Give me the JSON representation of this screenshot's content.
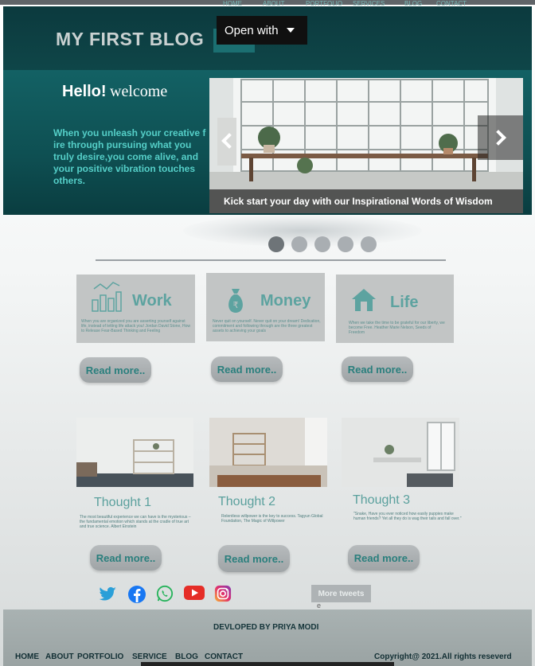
{
  "header": {
    "logo": "MY FIRST BLOG",
    "nav": [
      "HOME",
      "ABOUT",
      "PORTFOLIO",
      "SERVICES",
      "BLOG",
      "CONTACT"
    ],
    "open_with": "Open with"
  },
  "hero": {
    "hello": "Hello!",
    "welcome": "welcome",
    "quote": "When you unleash your creative f ire through pursuing what you truly desire,you come alive, and your positive vibration touches others."
  },
  "carousel": {
    "caption": "Kick start your day with our Inspirational Words of Wisdom",
    "slide_count": 5,
    "active_index": 0
  },
  "cards": [
    {
      "title": "Work",
      "text": "When you are organized you are asserting yourself against life, instead of letting life attack you! Jordan David Stone, How to Release Fear-Based Thinking and Feeling",
      "button": "Read more.."
    },
    {
      "title": "Money",
      "text": "Never quit on yourself. Never quit on your dream! Dedication, commitment and following through are the three greatest assets to achieving your goals",
      "button": "Read more.."
    },
    {
      "title": "Life",
      "text": "When we take the time to be grateful for our liberty, we become Free. Heather Marie Nelson, Seeds of Freedom",
      "button": "Read more.."
    }
  ],
  "thoughts": [
    {
      "title": "Thought 1",
      "text": "The most beautiful experience we can have is the mysterious – the fundamental emotion which stands at the cradle of true art and true science. Albert Einstein",
      "button": "Read more.."
    },
    {
      "title": "Thought 2",
      "text": "Relentless willpower is the key to success. Tagyun Global Foundation, The Magic of Willpower",
      "button": "Read more.."
    },
    {
      "title": "Thought 3",
      "text": "\"Snake, Have you ever noticed how easily puppies make human friends? Yet all they do is wag their tails and fall over.\"",
      "button": "Read more.."
    }
  ],
  "social": {
    "icons": [
      "twitter-icon",
      "facebook-icon",
      "whatsapp-icon",
      "youtube-icon",
      "instagram-icon"
    ],
    "more_tweets": "More tweets",
    "extra": "e"
  },
  "footer": {
    "developed": "DEVLOPED  BY PRIYA MODI",
    "nav": [
      "HOME",
      "ABOUT",
      "PORTFOLIO",
      "SERVICE",
      "BLOG",
      "CONTACT"
    ],
    "copyright": "Copyright@ 2021.All rights reseverd"
  },
  "colors": {
    "hero": "#0f4b4d",
    "accent": "#5da3a0",
    "quote": "#55cfc8",
    "card": "#c2c5c5"
  }
}
